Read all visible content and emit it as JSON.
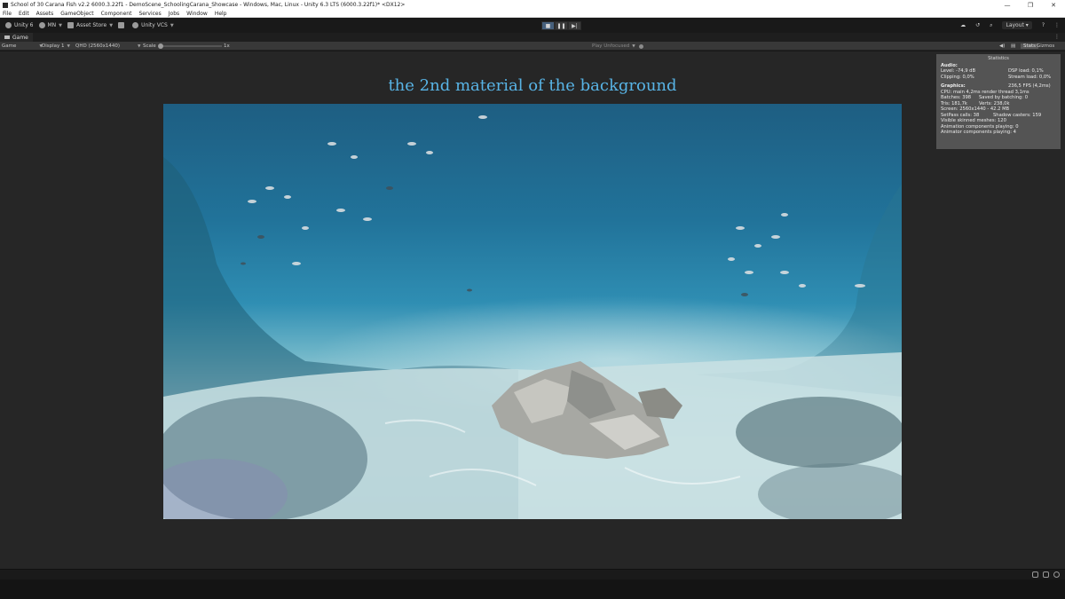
{
  "window": {
    "title": "School of 30 Carana Fish v2.2 6000.3.22f1 - DemoScene_SchoolingCarana_Showcase - Windows, Mac, Linux - Unity 6.3 LTS (6000.3.22f1)* <DX12>",
    "minimize": "—",
    "maximize": "❐",
    "close": "✕"
  },
  "menu": [
    "File",
    "Edit",
    "Assets",
    "GameObject",
    "Component",
    "Services",
    "Jobs",
    "Window",
    "Help"
  ],
  "toolbar": {
    "unity_label": "Unity 6",
    "account_label": "MN",
    "asset_store_label": "Asset Store",
    "vcs_label": "Unity VCS",
    "layout_label": "Layout",
    "play_icon": "■",
    "pause_icon": "❚❚",
    "step_icon": "▶|"
  },
  "tab": {
    "label": "Game",
    "more": "⋮"
  },
  "gamebar": {
    "view_mode": "Game",
    "display": "Display 1",
    "resolution": "QHD (2560x1440)",
    "scale_label": "Scale",
    "scale_value": "1x",
    "play_focus": "Play Unfocused",
    "stats_label": "Stats",
    "gizmos_label": "Gizmos"
  },
  "caption": "the 2nd material of the background",
  "stats": {
    "title": "Statistics",
    "audio_header": "Audio:",
    "level": "Level: -74,9 dB",
    "clipping": "Clipping: 0,0%",
    "dsp_load": "DSP load: 0,1%",
    "stream_load": "Stream load: 0,0%",
    "graphics_header": "Graphics:",
    "fps": "236,5 FPS (4,2ms)",
    "cpu": "CPU: main 4,2ms  render thread 3,1ms",
    "batches": "Batches: 398",
    "saved_batching": "Saved by batching: 0",
    "tris": "Tris: 181,7k",
    "verts": "Verts: 238,0k",
    "screen": "Screen: 2560x1440 - 42.2 MB",
    "setpass": "SetPass calls: 38",
    "shadow_casters": "Shadow casters: 159",
    "skinned": "Visible skinned meshes: 120",
    "anim_components": "Animation components playing: 0",
    "animator_components": "Animator components playing: 4"
  }
}
